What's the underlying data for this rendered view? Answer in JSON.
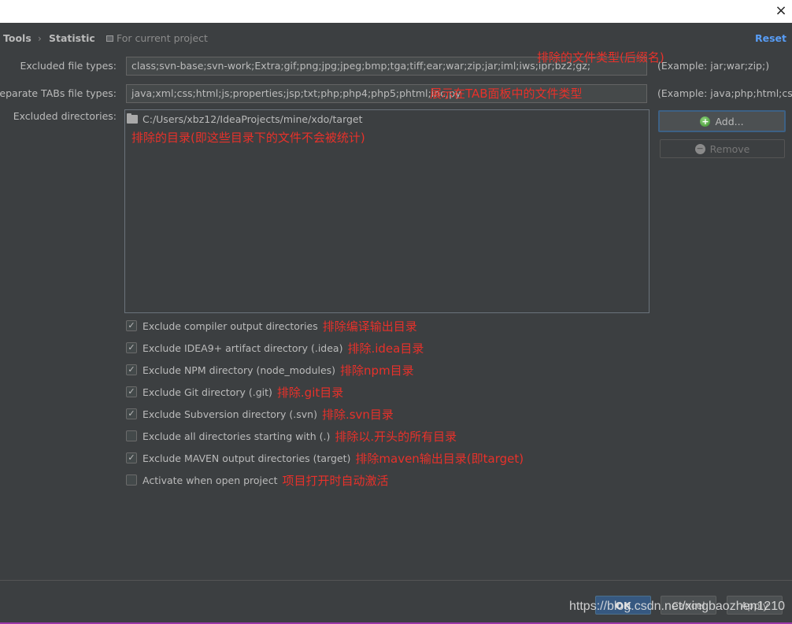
{
  "window": {
    "close_icon": "×"
  },
  "header": {
    "breadcrumb": [
      "Tools",
      "Statistic"
    ],
    "breadcrumb_separator": "›",
    "scope_label": "For current project",
    "reset_label": "Reset"
  },
  "fields": {
    "excluded_types": {
      "label": "Excluded file types:",
      "value": "class;svn-base;svn-work;Extra;gif;png;jpg;jpeg;bmp;tga;tiff;ear;war;zip;jar;iml;iws;ipr;bz2;gz;",
      "hint": "(Example: jar;war;zip;)",
      "note": "排除的文件类型(后缀名)"
    },
    "separate_tabs": {
      "label": "Separate TABs file types:",
      "value": "java;xml;css;html;js;properties;jsp;txt;php;php4;php5;phtml;inc;py",
      "hint": "(Example: java;php;html;css;)",
      "note": "展示在TAB面板中的文件类型"
    },
    "excluded_dirs": {
      "label": "Excluded directories:",
      "items": [
        "C:/Users/xbz12/IdeaProjects/mine/xdo/target"
      ],
      "note": "排除的目录(即这些目录下的文件不会被统计)"
    }
  },
  "dir_buttons": {
    "add": "Add...",
    "remove": "Remove"
  },
  "options": [
    {
      "label": "Exclude compiler output directories",
      "checked": true,
      "note": "排除编译输出目录"
    },
    {
      "label": "Exclude IDEA9+ artifact directory (.idea)",
      "checked": true,
      "note": "排除.idea目录"
    },
    {
      "label": "Exclude NPM directory (node_modules)",
      "checked": true,
      "note": "排除npm目录"
    },
    {
      "label": "Exclude Git directory (.git)",
      "checked": true,
      "note": "排除.git目录"
    },
    {
      "label": "Exclude Subversion directory (.svn)",
      "checked": true,
      "note": "排除.svn目录"
    },
    {
      "label": "Exclude all directories starting with (.)",
      "checked": false,
      "note": "排除以.开头的所有目录"
    },
    {
      "label": "Exclude MAVEN output directories (target)",
      "checked": true,
      "note": "排除maven输出目录(即target)"
    },
    {
      "label": "Activate when open project",
      "checked": false,
      "note": "项目打开时自动激活"
    }
  ],
  "footer": {
    "ok": "OK",
    "cancel": "Cancel",
    "apply": "Apply"
  },
  "watermark": "https://blog.csdn.net/xingbaozhen1210",
  "colors": {
    "accent": "#589df6",
    "annotation": "#e8312a",
    "primary_button": "#365880",
    "background": "#3c3f41"
  }
}
